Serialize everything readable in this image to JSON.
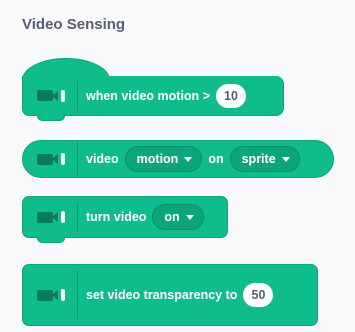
{
  "category": {
    "title": "Video Sensing"
  },
  "colors": {
    "block_fill": "#0fbd8c",
    "block_border": "#0da57a",
    "title_text": "#575e75"
  },
  "icons": {
    "extension": "video-camera-icon"
  },
  "blocks": {
    "when_motion": {
      "text": "when video motion >",
      "value": "10"
    },
    "sensing": {
      "text_pre": "video",
      "attribute": "motion",
      "text_mid": "on",
      "target": "sprite"
    },
    "turn_video": {
      "text": "turn video",
      "state": "on"
    },
    "transparency": {
      "text": "set video transparency to",
      "value": "50"
    }
  }
}
